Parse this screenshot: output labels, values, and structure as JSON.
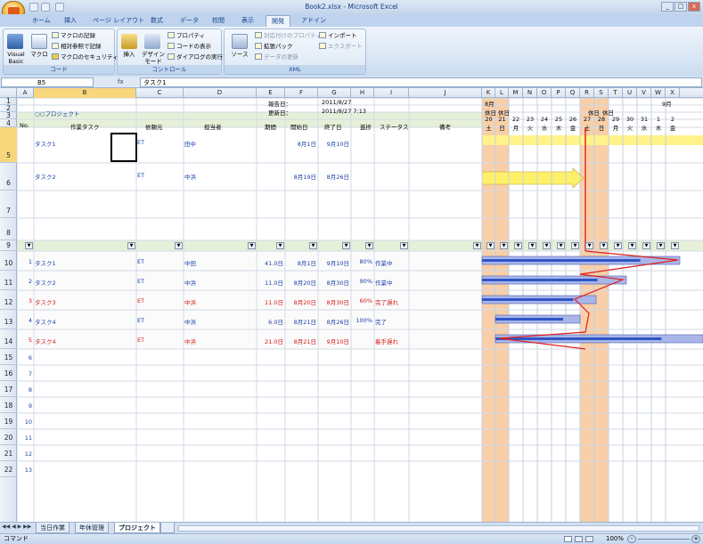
{
  "window": {
    "title": "Book2.xlsx - Microsoft Excel",
    "minimize": "_",
    "maximize": "□",
    "close": "x"
  },
  "tabs": [
    "ホーム",
    "挿入",
    "ページ レイアウト",
    "数式",
    "データ",
    "校閲",
    "表示",
    "開発",
    "アドイン"
  ],
  "active_tab": "開発",
  "ribbon": {
    "code": {
      "group": "コード",
      "visual_basic": "Visual Basic",
      "macro": "マクロ",
      "record": "マクロの記録",
      "relative": "相対参照で記録",
      "security": "マクロのセキュリティ"
    },
    "controls": {
      "group": "コントロール",
      "insert": "挿入",
      "design_mode": "デザイン モード",
      "properties": "プロパティ",
      "view_code": "コードの表示",
      "run_dialog": "ダイアログの実行"
    },
    "xml": {
      "group": "XML",
      "source": "ソース",
      "map_props": "対応付けのプロパティ",
      "expansion": "拡張パック",
      "refresh": "データの更新",
      "import": "インポート",
      "export": "エクスポート"
    }
  },
  "formula_bar": {
    "name_box": "B5",
    "fx": "fx",
    "value": "タスク1"
  },
  "columns": [
    "A",
    "B",
    "C",
    "D",
    "E",
    "F",
    "G",
    "H",
    "I",
    "J",
    "K",
    "L",
    "M",
    "N",
    "O",
    "P",
    "Q",
    "R",
    "S",
    "T",
    "U",
    "V",
    "W",
    "X"
  ],
  "rows": [
    "1",
    "2",
    "3",
    "4",
    "5",
    "6",
    "7",
    "8",
    "9",
    "10",
    "11",
    "12",
    "13",
    "14",
    "15",
    "16",
    "17",
    "18",
    "19",
    "20",
    "21",
    "22"
  ],
  "sheet": {
    "report_label": "報告日：",
    "report_date": "2011/8/27",
    "updated_label": "更新日：",
    "updated_date": "2011/8/27 7:13",
    "project": "○○プロジェクト",
    "headers": {
      "no": "No.",
      "task": "作業タスク",
      "client": "依頼元",
      "owner": "担当者",
      "period": "期間",
      "start": "開始日",
      "end": "終了日",
      "progress": "進捗",
      "status": "ステータス",
      "note": "備考"
    },
    "upper_tasks": [
      {
        "task": "タスク1",
        "client": "ET",
        "owner": "田中",
        "start": "8月1日",
        "end": "9月10日"
      },
      {
        "task": "タスク2",
        "client": "ET",
        "owner": "中浜",
        "start": "8月19日",
        "end": "8月26日"
      }
    ],
    "lower_tasks": [
      {
        "no": "1",
        "task": "タスク1",
        "client": "ET",
        "owner": "中田",
        "period": "41.0日",
        "start": "8月1日",
        "end": "9月10日",
        "progress": "80%",
        "status": "作業中",
        "late": false
      },
      {
        "no": "2",
        "task": "タスク2",
        "client": "ET",
        "owner": "中浜",
        "period": "11.0日",
        "start": "8月20日",
        "end": "8月30日",
        "progress": "90%",
        "status": "作業中",
        "late": false
      },
      {
        "no": "3",
        "task": "タスク3",
        "client": "ET",
        "owner": "中浜",
        "period": "11.0日",
        "start": "8月20日",
        "end": "8月30日",
        "progress": "60%",
        "status": "完了遅れ",
        "late": true
      },
      {
        "no": "4",
        "task": "タスク4",
        "client": "ET",
        "owner": "中浜",
        "period": "6.0日",
        "start": "8月21日",
        "end": "8月26日",
        "progress": "100%",
        "status": "完了",
        "late": false
      },
      {
        "no": "5",
        "task": "タスク4",
        "client": "ET",
        "owner": "中浜",
        "period": "21.0日",
        "start": "8月21日",
        "end": "9月10日",
        "progress": "",
        "status": "着手遅れ",
        "late": true
      }
    ],
    "extra_rows": [
      "6",
      "7",
      "8",
      "9",
      "10",
      "11",
      "12",
      "13"
    ],
    "gantt": {
      "month1": "8月",
      "month2": "9月",
      "holiday": "休日",
      "days": [
        "20",
        "21",
        "22",
        "23",
        "24",
        "25",
        "26",
        "27",
        "28",
        "29",
        "30",
        "31",
        "1",
        "2"
      ],
      "weekdays": [
        "土",
        "日",
        "月",
        "火",
        "水",
        "木",
        "金",
        "土",
        "日",
        "月",
        "火",
        "水",
        "木",
        "金"
      ],
      "holiday_color": "#f8cfa8",
      "today_line": "#e02020"
    }
  },
  "sheet_tabs": [
    "当日作業",
    "年休管理",
    "プロジェクト"
  ],
  "active_sheet": "プロジェクト",
  "status": {
    "mode": "コマンド",
    "zoom": "100%"
  }
}
